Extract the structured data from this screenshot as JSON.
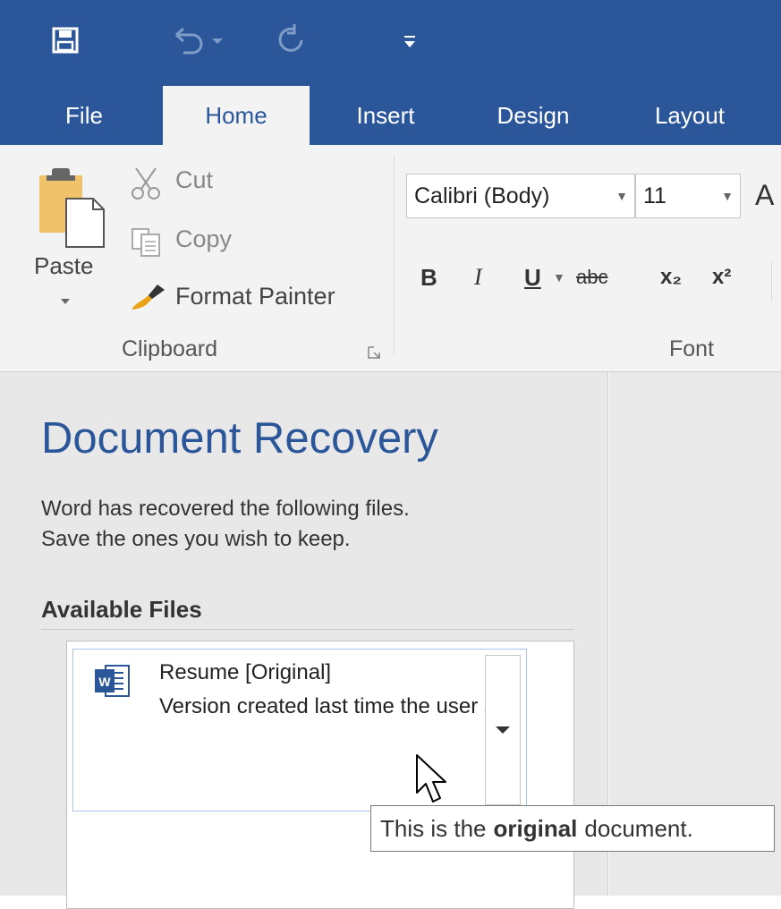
{
  "title_bar": {
    "customize_symbol": "⇄"
  },
  "tabs": [
    {
      "label": "File",
      "active": false
    },
    {
      "label": "Home",
      "active": true
    },
    {
      "label": "Insert",
      "active": false
    },
    {
      "label": "Design",
      "active": false
    },
    {
      "label": "Layout",
      "active": false
    }
  ],
  "clipboard": {
    "paste_label": "Paste",
    "cut_label": "Cut",
    "copy_label": "Copy",
    "format_painter_label": "Format Painter",
    "group_label": "Clipboard"
  },
  "font": {
    "family_value": "Calibri (Body)",
    "size_value": "11",
    "grow_label": "A",
    "bold_label": "B",
    "italic_label": "I",
    "underline_label": "U",
    "strike_label": "abc",
    "subscript_label": "x₂",
    "superscript_label": "x²",
    "group_label": "Font"
  },
  "recovery": {
    "title": "Document Recovery",
    "desc_line1": "Word has recovered the following files.",
    "desc_line2": "Save the ones you wish to keep.",
    "available_heading": "Available Files",
    "file": {
      "name": "Resume  [Original]",
      "description": "Version created last time the user saved the file"
    }
  },
  "tooltip": {
    "prefix": "This is the",
    "emphasis": "original",
    "suffix": "document."
  },
  "colors": {
    "accent": "#2b579a",
    "ribbon_bg": "#f3f3f3",
    "pane_bg": "#e8e8e8"
  }
}
